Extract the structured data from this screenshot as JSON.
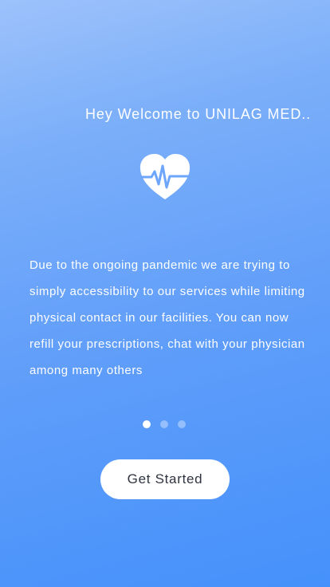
{
  "welcome": {
    "title": "Hey Welcome to UNILAG MED.."
  },
  "hero": {
    "icon": "heart-pulse-icon",
    "description": "Due to the ongoing pandemic we are trying to simply accessibility to our services while limiting physical contact in our facilities. You can now refill your prescriptions, chat with your physician among many others"
  },
  "pager": {
    "current_page": 1,
    "total_pages": 3
  },
  "actions": {
    "get_started": "Get Started"
  },
  "colors": {
    "gradient_start": "#9dc2fb",
    "gradient_end": "#4591fb",
    "button_background": "#ffffff",
    "button_text": "#2f3440"
  }
}
